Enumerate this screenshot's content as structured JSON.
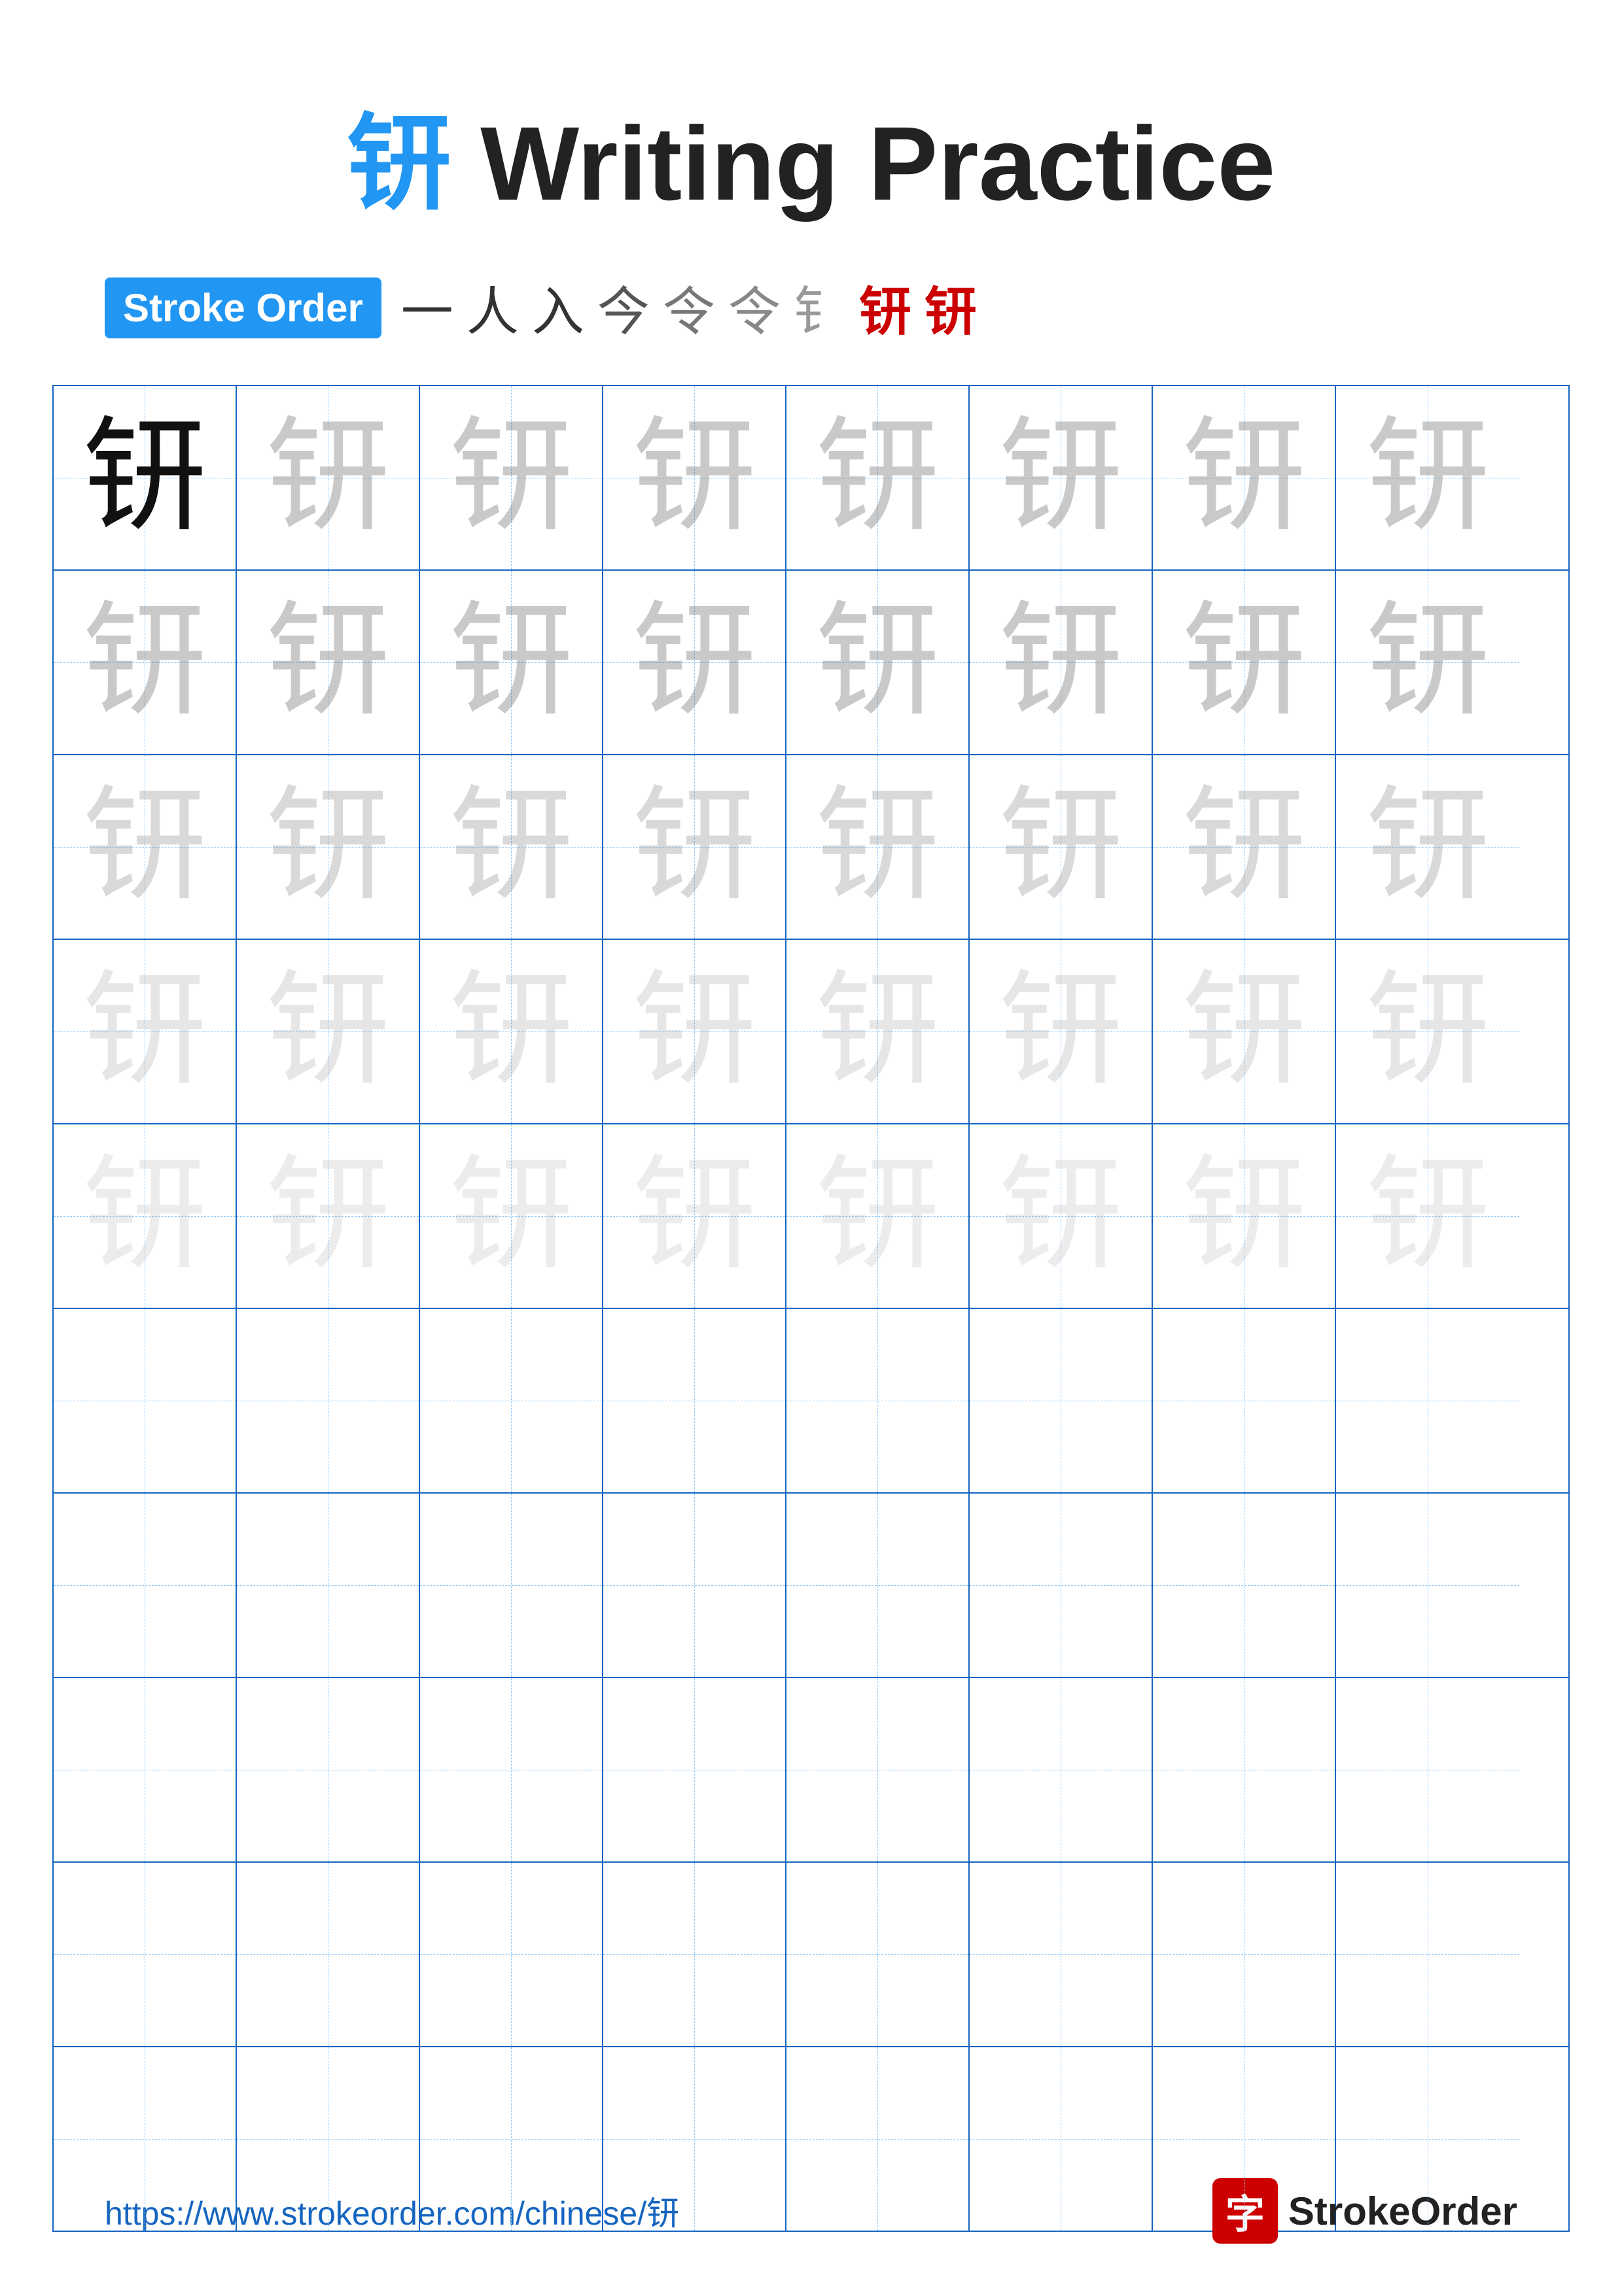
{
  "page": {
    "title_char": "钘",
    "title_text": " Writing Practice",
    "stroke_order_label": "Stroke Order",
    "stroke_steps": [
      "⼀",
      "⼈",
      "⼊",
      "今",
      "令",
      "令",
      "钅",
      "钘",
      "钘"
    ],
    "character": "钘",
    "footer_url": "https://www.strokeorder.com/chinese/钘",
    "footer_logo_char": "字",
    "footer_logo_name": "StrokeOrder",
    "grid_rows": 10,
    "grid_cols": 8
  }
}
